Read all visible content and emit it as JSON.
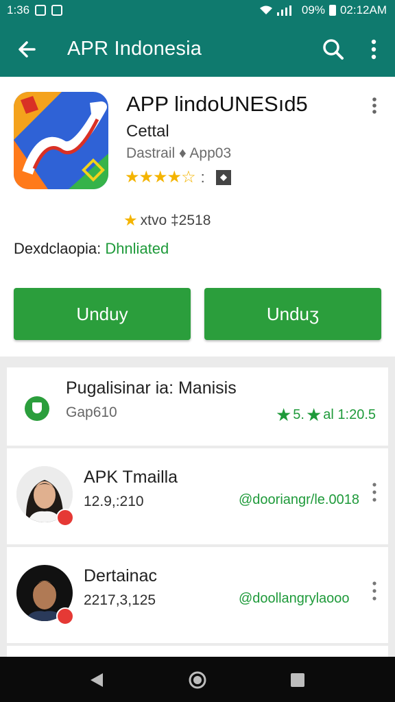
{
  "status_bar": {
    "time": "1:36",
    "battery": "09%",
    "clock": "02:12AM"
  },
  "app_bar": {
    "title": "APR Indonesia"
  },
  "hero": {
    "app_name": "APP lindoUNESıd5",
    "developer": "Cettal",
    "category": "Dastrail ♦ App03",
    "stars": "★★★★☆",
    "rating_colon": ":",
    "review_text": "xtvo ‡2518",
    "description_label": "Dexdclaopia:",
    "description_status": "Dhnliated",
    "buttons": [
      "Unduy",
      "Unduʒ"
    ]
  },
  "feature_card": {
    "title": "Pugalisinar ia: Manisis",
    "subtitle": "Gap610",
    "score_value": "5.",
    "score_text": "al 1:20.5"
  },
  "list_items": [
    {
      "title": "APK Tmailla",
      "subtitle": "12.9,:210",
      "link": "@dooriangr/le.0018"
    },
    {
      "title": "Dertainac",
      "subtitle": "2217,3,125",
      "link": "@doollangrylaooo"
    }
  ],
  "colors": {
    "primary": "#0f7a6e",
    "accent_green": "#2b9e3c",
    "star": "#f4b400"
  }
}
